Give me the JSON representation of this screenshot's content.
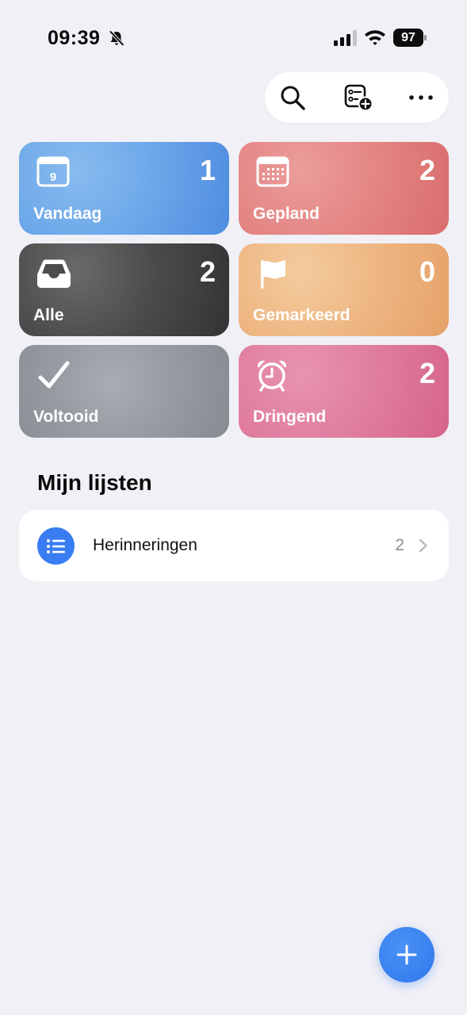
{
  "status_bar": {
    "time": "09:39",
    "battery_level": "97",
    "silent_icon": "bell-slash-icon",
    "signal_icon": "cellular-signal-icon",
    "wifi_icon": "wifi-icon"
  },
  "toolbar": {
    "search_icon": "search-icon",
    "add_list_icon": "add-list-icon",
    "more_icon": "more-icon"
  },
  "tiles": {
    "vandaag": {
      "label": "Vandaag",
      "count": "1",
      "icon": "calendar-day-icon",
      "calendar_day": "9",
      "color": "#6da8e9"
    },
    "gepland": {
      "label": "Gepland",
      "count": "2",
      "icon": "calendar-grid-icon",
      "color": "#e48684"
    },
    "alle": {
      "label": "Alle",
      "count": "2",
      "icon": "tray-icon",
      "color": "#4c4c4c"
    },
    "gemarkeerd": {
      "label": "Gemarkeerd",
      "count": "0",
      "icon": "flag-icon",
      "color": "#eeb784"
    },
    "voltooid": {
      "label": "Voltooid",
      "count": "",
      "icon": "checkmark-icon",
      "color": "#979ca3"
    },
    "dringend": {
      "label": "Dringend",
      "count": "2",
      "icon": "alarm-clock-icon",
      "color": "#e07ea0"
    }
  },
  "my_lists": {
    "title": "Mijn lijsten",
    "items": [
      {
        "name": "Herinneringen",
        "count": "2",
        "icon": "list-bullet-icon",
        "color": "#3a7df2"
      }
    ]
  },
  "fab": {
    "icon": "plus-icon",
    "color": "#3a82ef"
  }
}
